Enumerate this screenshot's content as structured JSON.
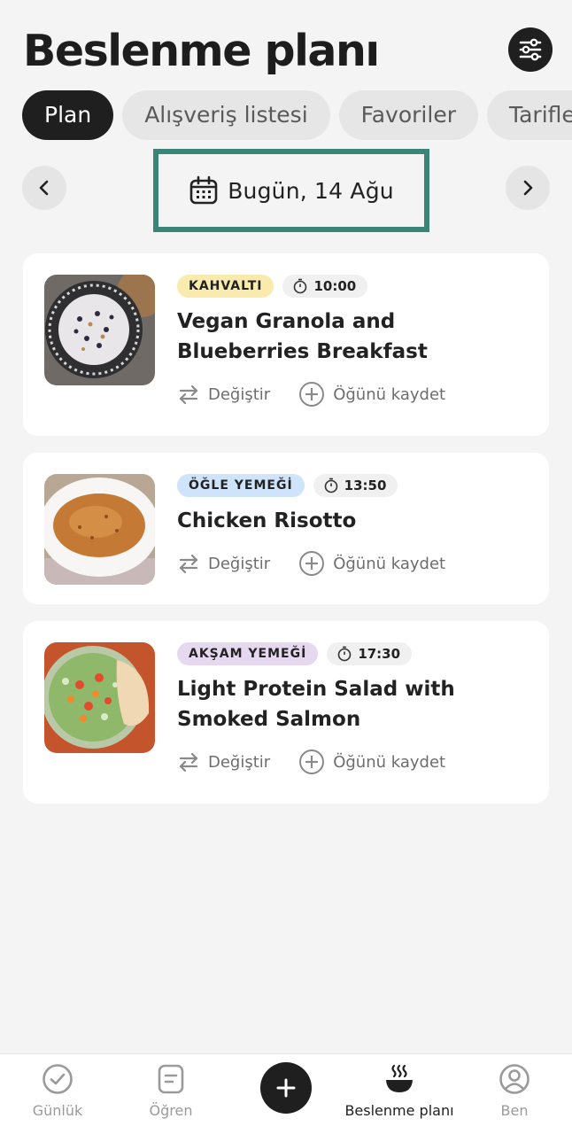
{
  "header": {
    "title": "Beslenme planı",
    "filter_icon": "sliders-icon"
  },
  "tabs": [
    {
      "label": "Plan",
      "active": true
    },
    {
      "label": "Alışveriş listesi",
      "active": false
    },
    {
      "label": "Favoriler",
      "active": false
    },
    {
      "label": "Tarifler",
      "active": false
    }
  ],
  "date_nav": {
    "label": "Bugün, 14 Ağu",
    "prev_icon": "chevron-left-icon",
    "next_icon": "chevron-right-icon",
    "calendar_icon": "calendar-icon"
  },
  "meals": [
    {
      "tag": "KAHVALTI",
      "tag_color": "#f9ebae",
      "time": "10:00",
      "title": "Vegan Granola and Blueberries Breakfast",
      "image": "granola-bowl-image"
    },
    {
      "tag": "ÖĞLE YEMEĞİ",
      "tag_color": "#cfe3fa",
      "time": "13:50",
      "title": "Chicken Risotto",
      "image": "risotto-plate-image"
    },
    {
      "tag": "AKŞAM YEMEĞİ",
      "tag_color": "#e6d8ef",
      "time": "17:30",
      "title": "Light Protein Salad with Smoked Salmon",
      "image": "salad-plate-image"
    }
  ],
  "actions": {
    "swap_label": "Değiştir",
    "save_label": "Öğünü kaydet"
  },
  "bottom_nav": [
    {
      "label": "Günlük",
      "icon": "check-circle-icon",
      "active": false
    },
    {
      "label": "Öğren",
      "icon": "document-icon",
      "active": false
    },
    {
      "label": "",
      "icon": "plus-icon",
      "active": false
    },
    {
      "label": "Beslenme planı",
      "icon": "food-bowl-icon",
      "active": true
    },
    {
      "label": "Ben",
      "icon": "profile-icon",
      "active": false
    }
  ],
  "colors": {
    "accent_frame": "#3b8478",
    "dark": "#1f1f1f",
    "background": "#f4f4f4"
  }
}
